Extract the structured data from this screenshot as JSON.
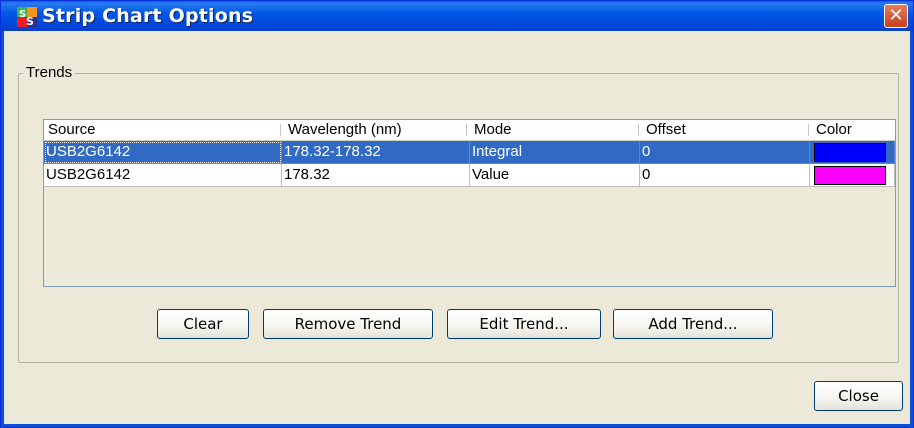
{
  "window": {
    "title": "Strip Chart Options",
    "close_glyph": "✕"
  },
  "trends": {
    "legend": "Trends",
    "columns": [
      "Source",
      "Wavelength (nm)",
      "Mode",
      "Offset",
      "Color"
    ],
    "rows": [
      {
        "source": "USB2G6142",
        "wavelength": "178.32-178.32",
        "mode": "Integral",
        "offset": "0",
        "color": "#0000ff",
        "selected": true
      },
      {
        "source": "USB2G6142",
        "wavelength": "178.32",
        "mode": "Value",
        "offset": "0",
        "color": "#ff00ff",
        "selected": false
      }
    ]
  },
  "buttons": {
    "clear": "Clear",
    "remove": "Remove Trend",
    "edit": "Edit Trend...",
    "add": "Add Trend...",
    "close": "Close"
  },
  "icons": {
    "app": "app-logo-icon",
    "close": "close-icon"
  },
  "colors": {
    "accent": "#316ac5",
    "titlebar": "#0058e6"
  }
}
